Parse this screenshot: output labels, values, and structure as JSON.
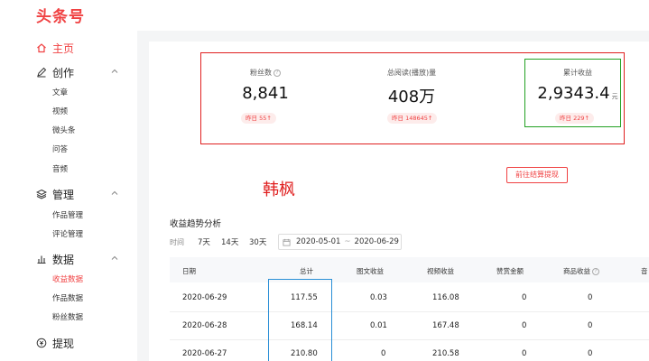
{
  "brand": {
    "logo": "头条号"
  },
  "sidebar": {
    "items": [
      {
        "label": "主页",
        "icon": "home-icon",
        "active": true
      },
      {
        "label": "创作",
        "icon": "pen-icon",
        "sub": [
          "文章",
          "视频",
          "微头条",
          "问答",
          "音频"
        ]
      },
      {
        "label": "管理",
        "icon": "layers-icon",
        "sub": [
          "作品管理",
          "评论管理"
        ]
      },
      {
        "label": "数据",
        "icon": "chart-icon",
        "sub": [
          "收益数据",
          "作品数据",
          "粉丝数据"
        ]
      },
      {
        "label": "提现",
        "icon": "coin-icon"
      }
    ],
    "active_sub": "收益数据"
  },
  "stats": [
    {
      "label": "粉丝数",
      "value": "8,841",
      "badge": "昨日 55↑"
    },
    {
      "label": "总阅读(播放)量",
      "value": "408万",
      "badge": "昨日 148645↑"
    },
    {
      "label": "累计收益",
      "value": "2,9343.4",
      "unit": "元",
      "badge": "昨日 229↑"
    }
  ],
  "withdraw_button": "前往结算提现",
  "author_name": "韩枫",
  "section": {
    "title": "收益趋势分析",
    "time_label": "时间",
    "filters": [
      "7天",
      "14天",
      "30天"
    ],
    "date_start": "2020-05-01",
    "date_sep": "~",
    "date_end": "2020-06-29"
  },
  "table": {
    "headers": [
      "日期",
      "总计",
      "图文收益",
      "视频收益",
      "赞赏金额",
      "商品收益",
      "音"
    ],
    "rows": [
      [
        "2020-06-29",
        "117.55",
        "0.03",
        "116.08",
        "0",
        "0"
      ],
      [
        "2020-06-28",
        "168.14",
        "0.01",
        "167.48",
        "0",
        "0"
      ],
      [
        "2020-06-27",
        "210.80",
        "0",
        "210.58",
        "0",
        "0"
      ]
    ]
  },
  "colors": {
    "brand_red": "#f04142",
    "annotation_red": "#e02020",
    "annotation_green": "#22a022",
    "annotation_blue": "#2a8fd6"
  }
}
